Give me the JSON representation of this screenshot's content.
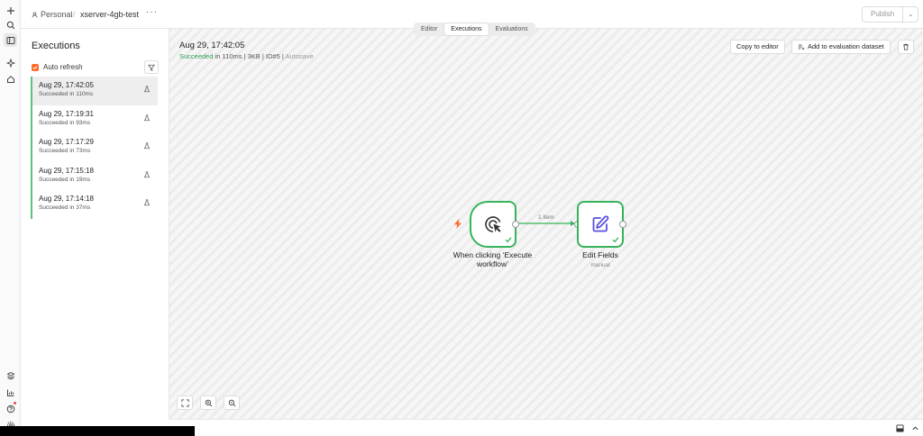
{
  "topbar": {
    "project": "Personal",
    "separator": "/",
    "workflow_name": "xserver-4gb-test",
    "more": "···",
    "publish_label": "Publish",
    "publish_chevron": "⌄"
  },
  "tabs": [
    {
      "label": "Editor",
      "active": false
    },
    {
      "label": "Executions",
      "active": true
    },
    {
      "label": "Evaluations",
      "active": false
    }
  ],
  "panel": {
    "title": "Executions",
    "auto_refresh_label": "Auto refresh",
    "auto_refresh_checked": true,
    "executions": [
      {
        "date": "Aug 29, 17:42:05",
        "status": "Succeeded in 110ms",
        "selected": true
      },
      {
        "date": "Aug 29, 17:19:31",
        "status": "Succeeded in 93ms",
        "selected": false
      },
      {
        "date": "Aug 29, 17:17:29",
        "status": "Succeeded in 73ms",
        "selected": false
      },
      {
        "date": "Aug 29, 17:15:18",
        "status": "Succeeded in 19ms",
        "selected": false
      },
      {
        "date": "Aug 29, 17:14:18",
        "status": "Succeeded in 37ms",
        "selected": false
      }
    ]
  },
  "detail": {
    "title": "Aug 29, 17:42:05",
    "status": "Succeeded",
    "duration": " in 110ms",
    "size": " | 3KB | ID#5 | ",
    "mode": "Autosave",
    "copy_label": "Copy to editor",
    "add_dataset_label": "Add to evaluation dataset"
  },
  "nodes": [
    {
      "label": "When clicking ‘Execute workflow’",
      "sub": ""
    },
    {
      "label": "Edit Fields",
      "sub": "manual"
    }
  ],
  "edge_label": "1 item",
  "colors": {
    "accent": "#ff6d2a",
    "success": "#35b35a",
    "node_icon": "#5b4fe0"
  }
}
